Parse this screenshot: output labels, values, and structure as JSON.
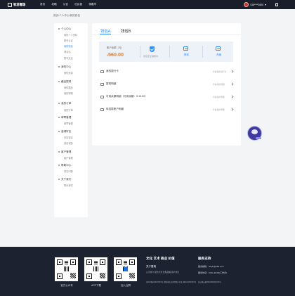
{
  "header": {
    "logo_text": "智游嘉瑞",
    "nav": [
      "首页",
      "攻略",
      "公告",
      "社区板",
      "领嘉币"
    ],
    "user_name": "136****2600"
  },
  "breadcrumb": "首页/个人中心/我的钱包",
  "sidebar": {
    "groups": [
      {
        "label": "个人中心",
        "items": [
          "我的个人资料",
          "账号认证",
          "我的钱包",
          "消息站",
          "账号安全"
        ]
      },
      {
        "label": "我的中心",
        "items": [
          "我的资源"
        ]
      },
      {
        "label": "藏品提现",
        "items": [
          "我的藏品",
          "我的转赠"
        ]
      },
      {
        "label": "我的订单",
        "items": [
          "我的订单"
        ]
      },
      {
        "label": "邮寄管理",
        "items": [
          "邮寄管理"
        ]
      },
      {
        "label": "邀请好友",
        "items": [
          "好友邀请",
          "邀请奖励"
        ]
      },
      {
        "label": "客户管理",
        "items": [
          "客户管理"
        ]
      },
      {
        "label": "帮助中心",
        "items": [
          "常见问题"
        ]
      },
      {
        "label": "关于我们",
        "items": [
          "联系我们"
        ]
      }
    ]
  },
  "wallet": {
    "tabs": [
      "钱包A",
      "钱包B"
    ],
    "balance_label": "账户余额（元）",
    "currency": "¥",
    "balance": "560.00",
    "security_text": "钱包安全保障中",
    "withdraw_label": "提现",
    "recharge_label": "充值",
    "rows": [
      {
        "label": "我的银行卡",
        "desc": "查看我的银行卡"
      },
      {
        "label": "提现明细",
        "desc": "查看我的明细"
      },
      {
        "label": "可用余额明细（可用余额：¥ 10.00）",
        "desc": "查看我的明细"
      },
      {
        "label": "待结算账户明细",
        "desc": "查看我的明细"
      }
    ]
  },
  "footer": {
    "qr_captions": [
      "官方公众号",
      "APP下载",
      "加入社群"
    ],
    "slogan": "文化 艺术 商业 价值",
    "support_title": "服务支持",
    "about_title": "关于嘉瑞",
    "links": "公司简介  服务条款  隐私政策  用户协议",
    "copyright": "浙ICP备2022047407号   增值电信业务经营许可证 浙B2-20230397号",
    "email": "服务邮箱：fenjin@163.com",
    "service_time": "服务时间：9:00~18:00(工作日)",
    "record": "浙公网安备33010602011979号"
  }
}
